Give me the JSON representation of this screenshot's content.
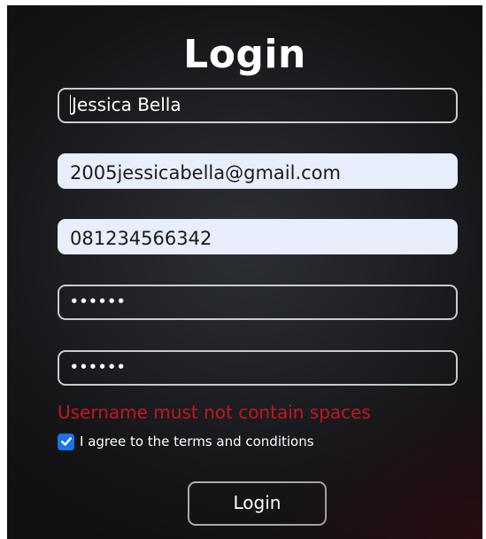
{
  "form": {
    "title": "Login",
    "fields": {
      "name": {
        "value": "Jessica Bella"
      },
      "email": {
        "value": "2005jessicabella@gmail.com"
      },
      "phone": {
        "value": "081234566342"
      },
      "password": {
        "value": "••••••"
      },
      "confirm_password": {
        "value": "••••••"
      }
    },
    "error_message": "Username must not contain spaces",
    "terms": {
      "checked": true,
      "label": "I agree to the terms and conditions"
    },
    "submit_label": "Login"
  },
  "colors": {
    "background": "#1e2024",
    "error": "#c5161f",
    "checkbox": "#1a73e8",
    "autofill_field": "#e8eefc"
  },
  "icons": {
    "checkbox": "checkmark-icon"
  }
}
